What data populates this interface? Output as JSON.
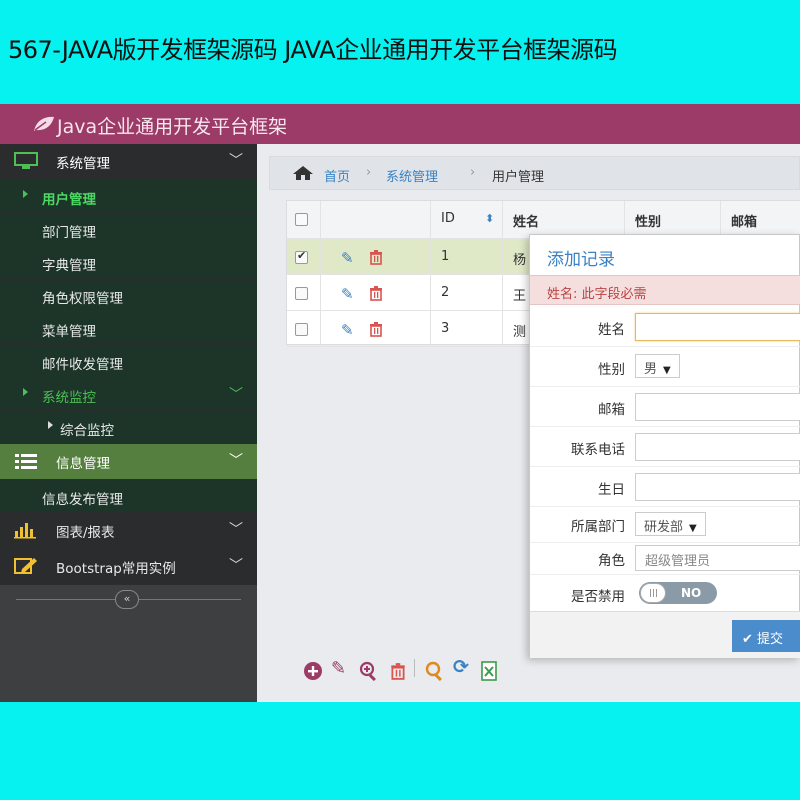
{
  "caption": "567-JAVA版开发框架源码 JAVA企业通用开发平台框架源码",
  "app": {
    "title": "Java企业通用开发平台框架"
  },
  "sidebar": {
    "groups": {
      "system": "系统管理",
      "user_mgmt": "用户管理",
      "dept_mgmt": "部门管理",
      "dict_mgmt": "字典管理",
      "role_mgmt": "角色权限管理",
      "menu_mgmt": "菜单管理",
      "mail_mgmt": "邮件收发管理",
      "monitor": "系统监控",
      "combined_monitor": "综合监控",
      "info": "信息管理",
      "info_publish": "信息发布管理",
      "charts": "图表/报表",
      "bootstrap": "Bootstrap常用实例"
    },
    "collapse_icon": "double-chevron-left-icon"
  },
  "breadcrumb": {
    "home": "首页",
    "section": "系统管理",
    "page": "用户管理"
  },
  "grid": {
    "columns": {
      "id": "ID",
      "name": "姓名",
      "gender": "性别",
      "email": "邮箱"
    },
    "rows": [
      {
        "id": "1",
        "name": "杨",
        "checked": true
      },
      {
        "id": "2",
        "name": "王",
        "checked": false
      },
      {
        "id": "3",
        "name": "测",
        "checked": false
      }
    ]
  },
  "modal": {
    "title": "添加记录",
    "error": "姓名: 此字段必需",
    "labels": {
      "name": "姓名",
      "gender": "性别",
      "email": "邮箱",
      "phone": "联系电话",
      "birthday": "生日",
      "department": "所属部门",
      "role": "角色",
      "disabled": "是否禁用"
    },
    "values": {
      "gender": "男",
      "department": "研发部",
      "role": "超级管理员",
      "disabled_toggle": "NO"
    },
    "submit": "提交"
  },
  "colors": {
    "header": "#9c3b67",
    "sidebar": "#3e3f40",
    "accent_green": "#4cbf55",
    "primary_blue": "#4a8ccc",
    "error_bg": "#f4dede"
  }
}
